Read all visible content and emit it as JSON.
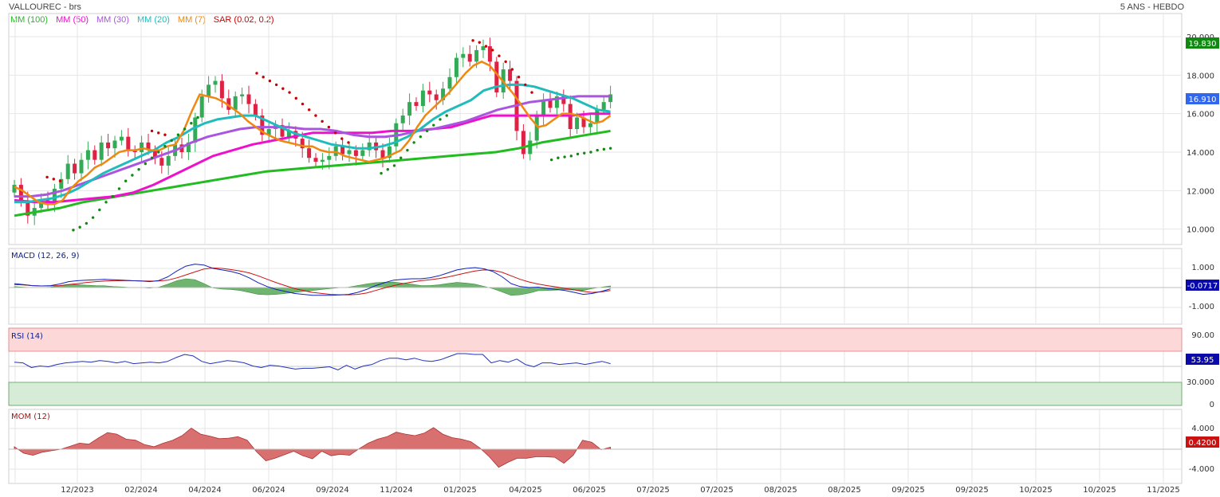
{
  "header": {
    "title": "VALLOUREC - brs",
    "period": "5 ANS - HEBDO"
  },
  "legend": [
    {
      "label": "MM (100)",
      "color": "#22bb22"
    },
    {
      "label": "MM (50)",
      "color": "#ee11cc"
    },
    {
      "label": "MM (30)",
      "color": "#aa55dd"
    },
    {
      "label": "MM (20)",
      "color": "#22bbbb"
    },
    {
      "label": "MM (7)",
      "color": "#ee8811"
    },
    {
      "label": "SAR (0.02, 0.2)",
      "color": "#cc0000"
    }
  ],
  "panels": {
    "macd": {
      "label": "MACD (12, 26, 9)",
      "value_badge": "-0.0717",
      "ticks": [
        "1.000",
        "0",
        "-1.000"
      ]
    },
    "rsi": {
      "label": "RSI (14)",
      "value_badge": "53.95",
      "ticks": [
        "90.00",
        "30.000",
        "0"
      ]
    },
    "mom": {
      "label": "MOM (12)",
      "value_badge": "0.4200",
      "ticks": [
        "4.000",
        "0",
        "-4.000"
      ]
    }
  },
  "price_badges": {
    "high": "19.830",
    "last": "16.910"
  },
  "colors": {
    "up": "#33aa55",
    "down": "#dd2244",
    "badge_green": "#118811",
    "badge_blue": "#3366ee",
    "badge_darkblue": "#0a0aaa",
    "badge_red": "#cc1111"
  },
  "chart_data": {
    "type": "candlestick",
    "x_labels": [
      "12/2023",
      "02/2024",
      "04/2024",
      "06/2024",
      "09/2024",
      "11/2024",
      "01/2025",
      "04/2025",
      "06/2025",
      "07/2025",
      "07/2025",
      "08/2025",
      "08/2025",
      "09/2025",
      "09/2025",
      "10/2025",
      "10/2025",
      "11/2025"
    ],
    "y_ticks": [
      "10.000",
      "12.000",
      "14.000",
      "16.000",
      "18.000",
      "20.000"
    ],
    "ylim": [
      9.2,
      21.2
    ],
    "close": [
      12.3,
      11.5,
      10.7,
      11.1,
      11.5,
      11.3,
      12.1,
      12.6,
      13.4,
      12.9,
      13.6,
      14.1,
      13.6,
      14.5,
      14.2,
      14.6,
      14.8,
      14.1,
      14.0,
      14.5,
      14.1,
      13.7,
      13.3,
      13.8,
      14.4,
      14.0,
      14.5,
      15.8,
      16.9,
      17.5,
      17.7,
      16.8,
      16.2,
      16.9,
      17.0,
      16.5,
      15.9,
      14.9,
      15.2,
      15.4,
      14.8,
      15.1,
      14.7,
      14.2,
      13.7,
      13.5,
      13.6,
      13.8,
      14.3,
      13.9,
      14.1,
      13.8,
      14.1,
      14.5,
      14.1,
      13.7,
      14.3,
      15.5,
      15.9,
      16.6,
      16.4,
      17.2,
      17.0,
      16.7,
      17.3,
      17.9,
      18.9,
      19.1,
      18.7,
      19.3,
      19.5,
      18.7,
      17.1,
      18.3,
      17.7,
      15.1,
      13.9,
      14.6,
      15.9,
      16.7,
      16.3,
      16.9,
      16.5,
      15.2,
      15.8,
      15.3,
      15.5,
      16.2,
      16.6,
      17.0
    ],
    "sma7": [
      12.2,
      12.0,
      11.7,
      11.4,
      11.3,
      11.3,
      11.5,
      12.1,
      12.5,
      12.8,
      13.2,
      13.4,
      13.7,
      14.0,
      14.1,
      14.1,
      14.2,
      14.1,
      14.1,
      14.3,
      14.4,
      15.1,
      16.1,
      17.0,
      16.9,
      16.8,
      16.6,
      16.3,
      16.0,
      15.6,
      15.3,
      15.0,
      14.8,
      14.6,
      14.5,
      14.4,
      14.3,
      14.3,
      14.1,
      14.0,
      14.0,
      13.8,
      13.7,
      13.6,
      13.5,
      13.6,
      13.7,
      13.9,
      14.1,
      14.6,
      15.3,
      15.9,
      16.3,
      16.7,
      17.1,
      17.6,
      18.1,
      18.5,
      18.7,
      18.5,
      18.0,
      17.5,
      17.0,
      16.4,
      15.8,
      15.3,
      15.4,
      15.7,
      16.0,
      16.0,
      15.9,
      15.7,
      15.5,
      15.6,
      15.9
    ],
    "sma20": [
      11.4,
      11.4,
      11.5,
      11.6,
      11.8,
      12.1,
      12.5,
      12.9,
      13.2,
      13.5,
      13.8,
      14.1,
      14.5,
      14.8,
      15.2,
      15.5,
      15.7,
      15.8,
      15.9,
      15.9,
      15.6,
      15.3,
      15.0,
      14.8,
      14.6,
      14.4,
      14.3,
      14.2,
      14.2,
      14.3,
      14.5,
      14.8,
      15.2,
      15.7,
      16.1,
      16.4,
      16.7,
      17.2,
      17.4,
      17.5,
      17.5,
      17.4,
      17.2,
      17.0,
      16.8,
      16.5,
      16.2,
      16.1
    ],
    "sma30": [
      11.7,
      11.7,
      11.8,
      12.0,
      12.3,
      12.6,
      12.9,
      13.2,
      13.5,
      13.8,
      14.1,
      14.5,
      14.8,
      15.0,
      15.2,
      15.3,
      15.3,
      15.3,
      15.2,
      15.2,
      15.1,
      14.9,
      14.8,
      14.8,
      14.9,
      15.1,
      15.2,
      15.4,
      15.6,
      15.9,
      16.2,
      16.4,
      16.6,
      16.7,
      16.8,
      16.9,
      16.9,
      16.9
    ],
    "sma50": [
      11.5,
      11.4,
      11.4,
      11.5,
      11.6,
      11.7,
      11.9,
      12.3,
      12.8,
      13.3,
      13.8,
      14.1,
      14.4,
      14.6,
      14.8,
      15.0,
      15.0,
      15.0,
      15.0,
      15.1,
      15.1,
      15.2,
      15.3,
      15.6,
      15.9,
      15.9,
      15.9,
      15.9,
      15.9,
      16.0,
      16.0
    ],
    "sma100": [
      10.7,
      10.9,
      11.1,
      11.4,
      11.6,
      11.8,
      12.0,
      12.2,
      12.4,
      12.6,
      12.8,
      13.0,
      13.1,
      13.2,
      13.3,
      13.4,
      13.5,
      13.6,
      13.7,
      13.8,
      13.9,
      14.0,
      14.2,
      14.5,
      14.7,
      14.9,
      15.1
    ],
    "sar_below": [
      [
        9,
        9.95
      ],
      [
        10,
        10.1
      ],
      [
        11,
        10.3
      ],
      [
        12,
        10.6
      ],
      [
        13,
        11.0
      ],
      [
        14,
        11.4
      ],
      [
        15,
        11.7
      ],
      [
        16,
        12.1
      ],
      [
        17,
        12.5
      ],
      [
        18,
        12.8
      ],
      [
        19,
        13.1
      ],
      [
        20,
        13.4
      ],
      [
        21,
        13.7
      ],
      [
        22,
        14.0
      ],
      [
        23,
        14.3
      ],
      [
        24,
        14.6
      ],
      [
        25,
        14.9
      ],
      [
        26,
        15.2
      ],
      [
        27,
        15.5
      ],
      [
        28,
        15.8
      ],
      [
        56,
        12.9
      ],
      [
        57,
        13.1
      ],
      [
        58,
        13.3
      ],
      [
        59,
        13.7
      ],
      [
        60,
        14.1
      ],
      [
        61,
        14.5
      ],
      [
        62,
        14.8
      ],
      [
        63,
        15.1
      ],
      [
        64,
        15.4
      ],
      [
        65,
        15.7
      ],
      [
        66,
        15.9
      ],
      [
        82,
        13.6
      ],
      [
        83,
        13.7
      ],
      [
        84,
        13.75
      ],
      [
        85,
        13.8
      ],
      [
        86,
        13.9
      ],
      [
        87,
        13.95
      ],
      [
        88,
        14.0
      ],
      [
        89,
        14.1
      ],
      [
        90,
        14.15
      ],
      [
        91,
        14.2
      ]
    ],
    "sar_above": [
      [
        5,
        12.7
      ],
      [
        6,
        12.6
      ],
      [
        7,
        12.5
      ],
      [
        21,
        15.1
      ],
      [
        22,
        15.0
      ],
      [
        23,
        14.9
      ],
      [
        37,
        18.1
      ],
      [
        38,
        17.9
      ],
      [
        39,
        17.7
      ],
      [
        40,
        17.5
      ],
      [
        41,
        17.3
      ],
      [
        42,
        17.1
      ],
      [
        43,
        16.8
      ],
      [
        44,
        16.5
      ],
      [
        45,
        16.2
      ],
      [
        46,
        15.9
      ],
      [
        47,
        15.6
      ],
      [
        48,
        15.3
      ],
      [
        49,
        15.0
      ],
      [
        50,
        14.7
      ],
      [
        51,
        14.5
      ],
      [
        70,
        19.8
      ],
      [
        71,
        19.7
      ],
      [
        72,
        19.5
      ],
      [
        73,
        19.3
      ],
      [
        74,
        19.0
      ],
      [
        75,
        18.7
      ],
      [
        76,
        18.3
      ],
      [
        77,
        17.9
      ],
      [
        78,
        17.5
      ],
      [
        79,
        17.1
      ]
    ],
    "macd_line": [
      0.2,
      0.15,
      0.1,
      0.08,
      0.1,
      0.18,
      0.3,
      0.35,
      0.38,
      0.4,
      0.42,
      0.4,
      0.38,
      0.35,
      0.34,
      0.3,
      0.36,
      0.55,
      0.85,
      1.1,
      1.2,
      1.15,
      0.98,
      0.9,
      0.82,
      0.7,
      0.5,
      0.25,
      0.05,
      -0.1,
      -0.2,
      -0.3,
      -0.35,
      -0.4,
      -0.4,
      -0.4,
      -0.38,
      -0.35,
      -0.25,
      -0.1,
      0.1,
      0.25,
      0.38,
      0.42,
      0.45,
      0.45,
      0.5,
      0.6,
      0.75,
      0.9,
      0.98,
      1.02,
      0.96,
      0.82,
      0.55,
      0.2,
      0.05,
      0.0,
      0.02,
      -0.05,
      -0.1,
      -0.15,
      -0.25,
      -0.35,
      -0.3,
      -0.2,
      -0.07
    ],
    "macd_signal": [
      0.15,
      0.13,
      0.1,
      0.08,
      0.08,
      0.1,
      0.15,
      0.2,
      0.26,
      0.3,
      0.33,
      0.35,
      0.35,
      0.35,
      0.34,
      0.33,
      0.34,
      0.38,
      0.5,
      0.65,
      0.8,
      0.95,
      1.0,
      0.98,
      0.92,
      0.85,
      0.75,
      0.6,
      0.42,
      0.25,
      0.1,
      -0.05,
      -0.15,
      -0.25,
      -0.3,
      -0.35,
      -0.37,
      -0.37,
      -0.35,
      -0.28,
      -0.15,
      -0.02,
      0.1,
      0.2,
      0.28,
      0.35,
      0.4,
      0.46,
      0.54,
      0.64,
      0.75,
      0.85,
      0.9,
      0.88,
      0.78,
      0.6,
      0.42,
      0.28,
      0.18,
      0.1,
      0.03,
      -0.05,
      -0.12,
      -0.2,
      -0.25,
      -0.22,
      -0.15
    ],
    "rsi": [
      56,
      55,
      49,
      51,
      50,
      53,
      55,
      56,
      57,
      56,
      58,
      57,
      55,
      57,
      54,
      55,
      56,
      55,
      57,
      62,
      66,
      64,
      57,
      54,
      56,
      58,
      57,
      55,
      51,
      49,
      52,
      51,
      49,
      47,
      48,
      48,
      49,
      50,
      46,
      52,
      47,
      51,
      53,
      58,
      61,
      61,
      59,
      61,
      58,
      57,
      59,
      63,
      67,
      67,
      66,
      66,
      55,
      58,
      56,
      60,
      53,
      50,
      55,
      55,
      53,
      54,
      55,
      53,
      55,
      57,
      54
    ],
    "mom": [
      0.5,
      -0.8,
      -1.2,
      -0.6,
      -0.3,
      0.0,
      0.6,
      1.2,
      1.0,
      2.2,
      3.3,
      3.0,
      2.0,
      1.8,
      0.9,
      0.5,
      1.2,
      1.8,
      2.7,
      4.2,
      3.0,
      2.6,
      2.1,
      2.2,
      2.5,
      1.8,
      -0.5,
      -2.3,
      -1.8,
      -1.1,
      -0.4,
      -1.3,
      -1.9,
      -0.4,
      -1.3,
      -1.0,
      -1.2,
      0.1,
      1.2,
      2.0,
      2.5,
      3.4,
      3.0,
      2.7,
      3.2,
      4.3,
      3.0,
      2.3,
      2.0,
      1.5,
      0.2,
      -1.5,
      -3.6,
      -2.6,
      -1.8,
      -1.8,
      -1.5,
      -1.5,
      -1.6,
      -2.8,
      -1.2,
      1.8,
      1.4,
      -0.1,
      0.4
    ]
  }
}
